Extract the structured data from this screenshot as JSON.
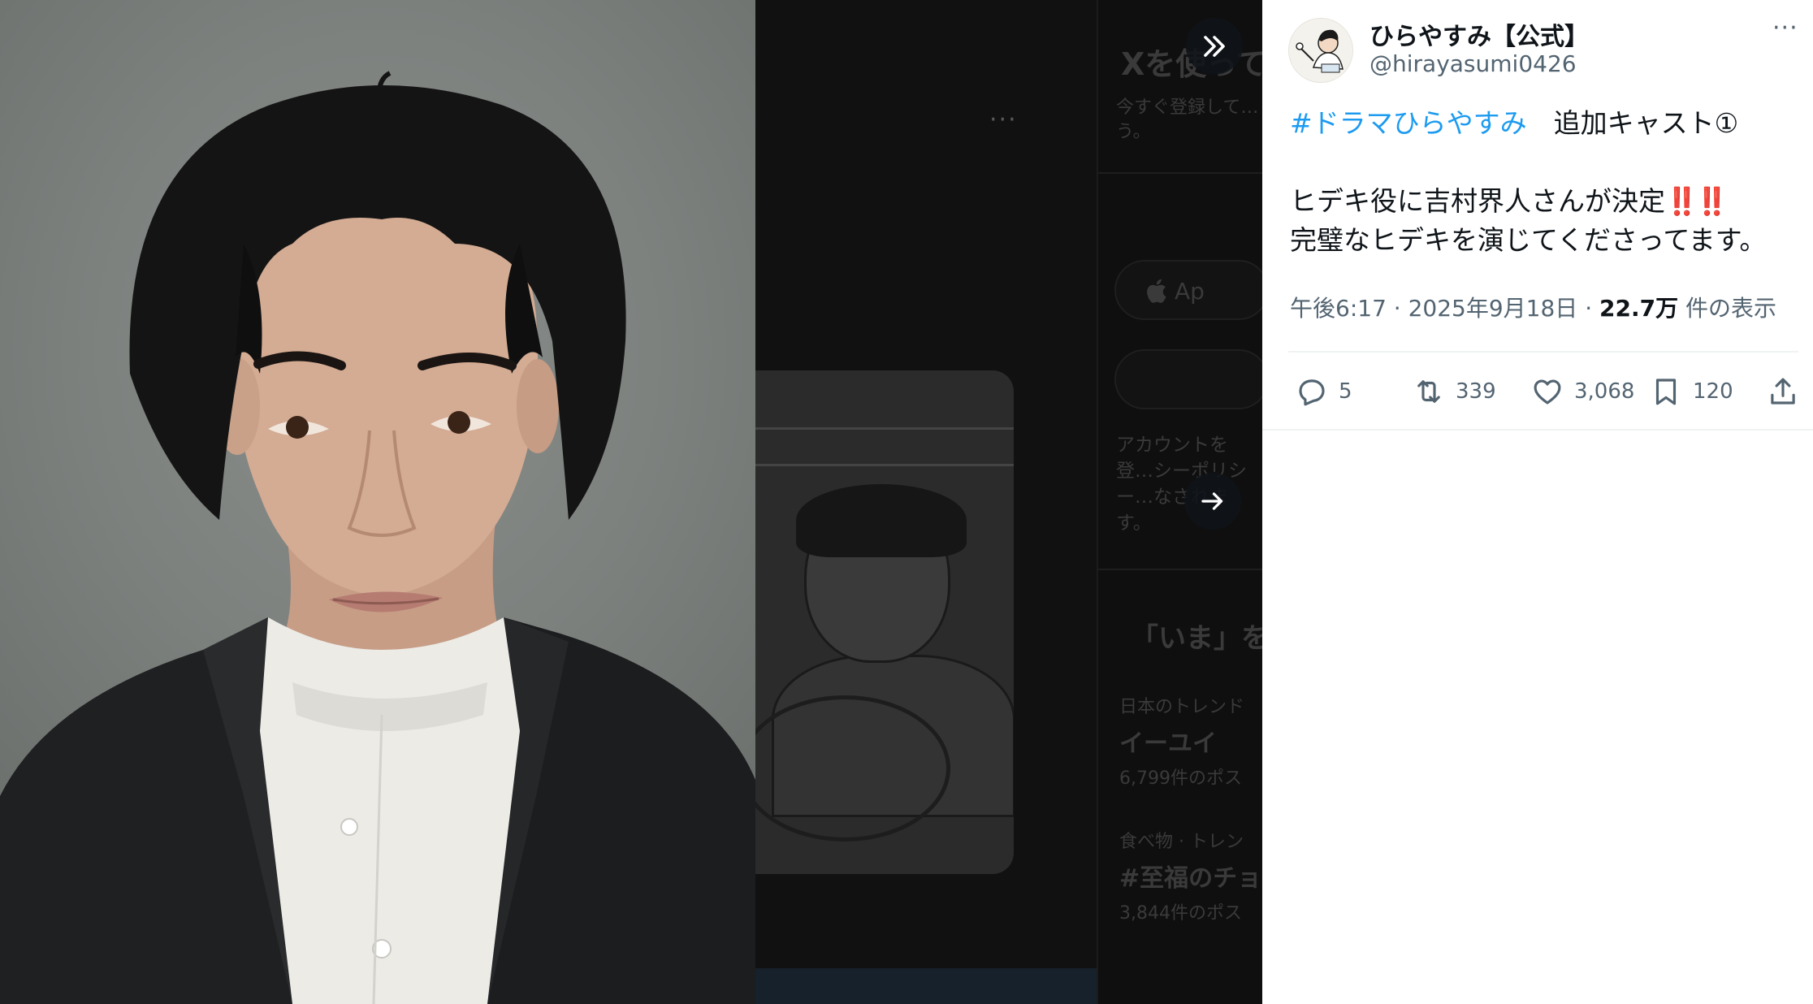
{
  "account": {
    "display_name": "ひらやすみ【公式】",
    "handle": "@hirayasumi0426"
  },
  "tweet": {
    "hashtag": "#ドラマひらやすみ",
    "headline": "追加キャスト①",
    "line1": "ヒデキ役に吉村界人さんが決定",
    "line1_emoji": "‼️‼️",
    "line2": "完璧なヒデキを演じてくださってます。"
  },
  "meta": {
    "time": "午後6:17",
    "separator": "·",
    "date": "2025年9月18日",
    "views": "22.7万",
    "views_label": "件の表示"
  },
  "actions": {
    "replies": "5",
    "retweets": "339",
    "likes": "3,068",
    "bookmarks": "120"
  },
  "background_page": {
    "title": "Xを使って",
    "subtitle": "今すぐ登録して…う。",
    "apple_button": "Ap",
    "legal": "アカウントを登…シーポリシー…なされます。",
    "trends_heading": "「いま」を",
    "trend1_category": "日本のトレンド",
    "trend1_name": "イーユイ",
    "trend1_count": "6,799件のポス",
    "trend2_category": "食べ物 · トレン",
    "trend2_name": "#至福のチョ",
    "trend2_count": "3,844件のポス"
  },
  "colors": {
    "link": "#1d9bf0",
    "text": "#0f1419",
    "muted": "#536471",
    "emoji_red": "#f4212e"
  }
}
